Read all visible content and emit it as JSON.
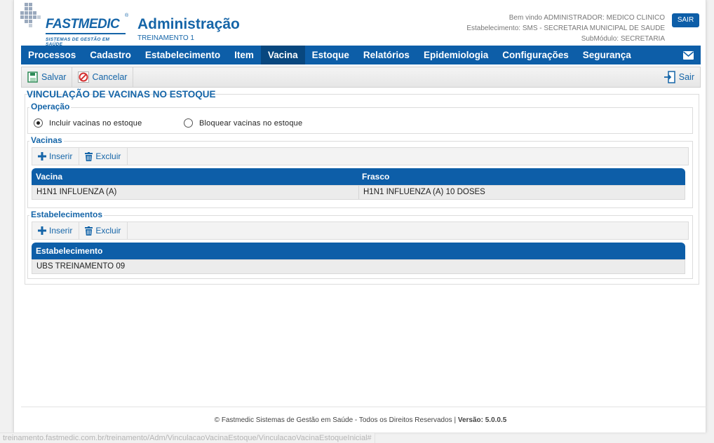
{
  "header": {
    "logo_text": "FASTMEDIC",
    "logo_reg": "®",
    "logo_tagline": "SISTEMAS DE GESTÃO EM SAÚDE",
    "title": "Administração",
    "subtitle": "TREINAMENTO 1",
    "welcome": "Bem vindo ADMINISTRADOR: MEDICO CLINICO",
    "establishment": "Estabelecimento: SMS - SECRETARIA MUNICIPAL DE SAUDE",
    "submodule": "SubMódulo: SECRETARIA",
    "logout_label": "SAIR"
  },
  "nav": {
    "items": [
      {
        "label": "Processos"
      },
      {
        "label": "Cadastro"
      },
      {
        "label": "Estabelecimento"
      },
      {
        "label": "Item"
      },
      {
        "label": "Vacina",
        "active": true
      },
      {
        "label": "Estoque"
      },
      {
        "label": "Relatórios"
      },
      {
        "label": "Epidemiologia"
      },
      {
        "label": "Configurações"
      },
      {
        "label": "Segurança"
      }
    ],
    "mail_icon": "envelope-icon"
  },
  "toolbar": {
    "save_label": "Salvar",
    "cancel_label": "Cancelar",
    "exit_label": "Sair"
  },
  "form": {
    "title": "VINCULAÇÃO DE VACINAS NO ESTOQUE",
    "operation": {
      "legend": "Operação",
      "options": [
        {
          "label": "Incluir vacinas no estoque",
          "checked": true
        },
        {
          "label": "Bloquear vacinas no estoque",
          "checked": false
        }
      ]
    },
    "vaccines": {
      "legend": "Vacinas",
      "insert_label": "Inserir",
      "delete_label": "Excluir",
      "columns": [
        "Vacina",
        "Frasco"
      ],
      "rows": [
        [
          "H1N1 INFLUENZA (A)",
          "H1N1 INFLUENZA (A) 10 DOSES"
        ]
      ]
    },
    "establishments": {
      "legend": "Estabelecimentos",
      "insert_label": "Inserir",
      "delete_label": "Excluir",
      "columns": [
        "Estabelecimento"
      ],
      "rows": [
        [
          "UBS TREINAMENTO 09"
        ]
      ]
    }
  },
  "footer": {
    "text": "© Fastmedic Sistemas de Gestão em Saúde - Todos os Direitos Reservados |",
    "version_label": "Versão: 5.0.0.5"
  },
  "status_bar": {
    "url": "treinamento.fastmedic.com.br/treinamento/Adm/VinculacaoVacinaEstoque/VinculacaoVacinaEstoqueInicial#"
  },
  "colors": {
    "primary": "#0d5ea8",
    "primary_dark": "#08477f",
    "cancel_red": "#d32f2f",
    "save_green": "#2e8b57"
  }
}
